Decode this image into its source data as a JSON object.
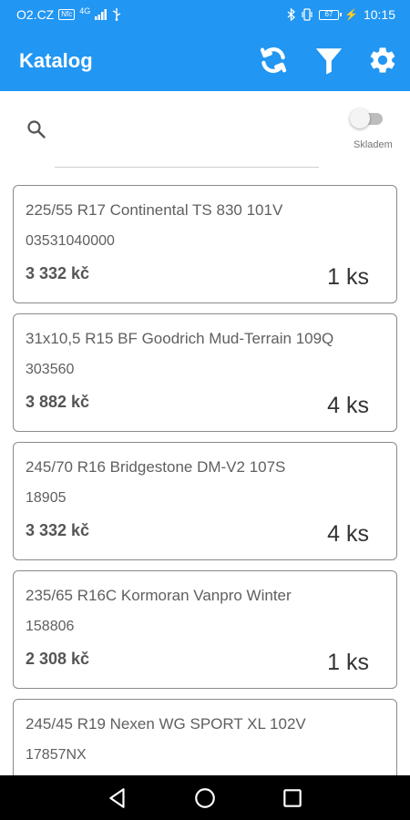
{
  "status_bar": {
    "carrier": "O2.CZ",
    "network_badge": "Nfc",
    "signal": "4G",
    "battery": "67",
    "time": "10:15"
  },
  "app_bar": {
    "title": "Katalog",
    "icons": [
      "refresh-icon",
      "filter-icon",
      "settings-icon"
    ]
  },
  "search": {
    "placeholder": "",
    "value": ""
  },
  "stock_toggle": {
    "label": "Skladem",
    "on": false
  },
  "products": [
    {
      "name": "225/55 R17 Continental TS 830 101V",
      "code": "03531040000",
      "price": "3 332 kč",
      "qty": "1 ks"
    },
    {
      "name": "31x10,5 R15 BF Goodrich Mud-Terrain 109Q",
      "code": "303560",
      "price": "3 882 kč",
      "qty": "4 ks"
    },
    {
      "name": "245/70 R16 Bridgestone DM-V2 107S",
      "code": "18905",
      "price": "3 332 kč",
      "qty": "4 ks"
    },
    {
      "name": "235/65 R16C Kormoran Vanpro Winter",
      "code": "158806",
      "price": "2 308 kč",
      "qty": "1 ks"
    },
    {
      "name": "245/45 R19 Nexen WG SPORT XL 102V",
      "code": "17857NX",
      "price": "",
      "qty": ""
    }
  ],
  "colors": {
    "primary": "#2196f3",
    "card_border": "#8a8a8a",
    "text": "#5f5f5f"
  }
}
